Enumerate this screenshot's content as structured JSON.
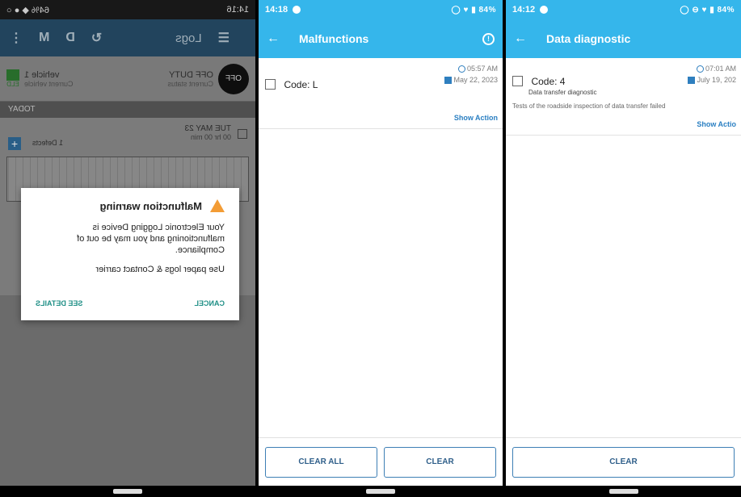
{
  "panel1": {
    "status": {
      "time": "14:16",
      "right": "64% ◆ ● ○"
    },
    "topbar": {
      "title": "Logs",
      "icons": [
        "M",
        "D"
      ]
    },
    "vehicle": {
      "status_btn": "OFF",
      "status": "OFF DUTY",
      "status_sub": "Current status",
      "vehicle": "vehicle 1",
      "vehicle_sub": "Current vehicle",
      "vehicle_icon_label": "ELD"
    },
    "today": "TODAY",
    "day": {
      "date": "TUE MAY 23",
      "hours": "00 hr 00 min",
      "defects": "1 Defects"
    },
    "dialog": {
      "title": "Malfunction warning",
      "body": "Your Electronic Logging Device is malfunctioning and you may be out of Compliance.",
      "body2": "Use paper logs & Contact carrier",
      "cancel": "CANCEL",
      "details": "SEE DETAILS"
    }
  },
  "panel2": {
    "status": {
      "time": "14:18",
      "right": "84%"
    },
    "title": "Malfunctions",
    "item": {
      "code": "Code: L",
      "time": "05:57 AM",
      "date": "May 22, 2023",
      "action": "Show Action"
    },
    "buttons": {
      "clear_all": "CLEAR ALL",
      "clear": "CLEAR"
    }
  },
  "panel3": {
    "status": {
      "time": "14:12",
      "right": "84%"
    },
    "title": "Data diagnostic",
    "item": {
      "code": "Code: 4",
      "time": "07:01 AM",
      "date": "July 19, 202",
      "sub": "Data transfer diagnostic",
      "desc": "Tests of the roadside inspection of data transfer failed",
      "action": "Show Actio"
    },
    "buttons": {
      "clear": "CLEAR"
    }
  }
}
